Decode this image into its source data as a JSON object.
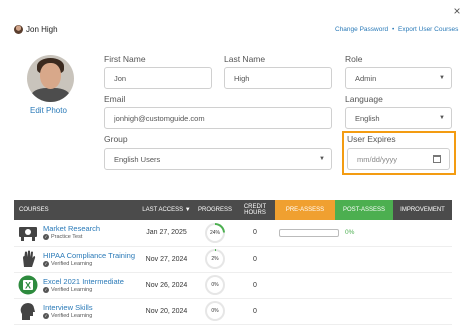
{
  "header": {
    "user_name": "Jon High",
    "change_password": "Change Password",
    "separator": "•",
    "export_courses": "Export User Courses",
    "close": "×"
  },
  "profile": {
    "edit_photo": "Edit Photo"
  },
  "form": {
    "first_name": {
      "label": "First Name",
      "value": "Jon"
    },
    "last_name": {
      "label": "Last Name",
      "value": "High"
    },
    "role": {
      "label": "Role",
      "value": "Admin"
    },
    "email": {
      "label": "Email",
      "value": "jonhigh@customguide.com"
    },
    "language": {
      "label": "Language",
      "value": "English"
    },
    "group": {
      "label": "Group",
      "value": "English Users"
    },
    "user_expires": {
      "label": "User Expires",
      "placeholder": "mm/dd/yyyy"
    }
  },
  "table": {
    "headers": {
      "courses": "COURSES",
      "last_access": "LAST ACCESS ▼",
      "progress": "PROGRESS",
      "credit_hours": "CREDIT HOURS",
      "pre_assess": "PRE-ASSESS",
      "post_assess": "POST-ASSESS",
      "improvement": "IMPROVEMENT"
    },
    "rows": [
      {
        "title": "Market Research",
        "subtitle": "Practice Test",
        "last_access": "Jan 27, 2025",
        "progress_label": "24%",
        "progress": 24,
        "credit_hours": "0",
        "pre_assess_pct": "0%"
      },
      {
        "title": "HIPAA Compliance Training",
        "subtitle": "Verified Learning",
        "last_access": "Nov 27, 2024",
        "progress_label": "2%",
        "progress": 2,
        "credit_hours": "0",
        "pre_assess_pct": ""
      },
      {
        "title": "Excel 2021 Intermediate",
        "subtitle": "Verified Learning",
        "last_access": "Nov 26, 2024",
        "progress_label": "0%",
        "progress": 0,
        "credit_hours": "0",
        "pre_assess_pct": ""
      },
      {
        "title": "Interview Skills",
        "subtitle": "Verified Learning",
        "last_access": "Nov 20, 2024",
        "progress_label": "0%",
        "progress": 0,
        "credit_hours": "0",
        "pre_assess_pct": ""
      }
    ]
  },
  "colors": {
    "link": "#2a7ab8",
    "highlight": "#f39c12",
    "pre_assess": "#f0a030",
    "post_assess": "#4caf50",
    "progress_ring": "#4caf50"
  }
}
